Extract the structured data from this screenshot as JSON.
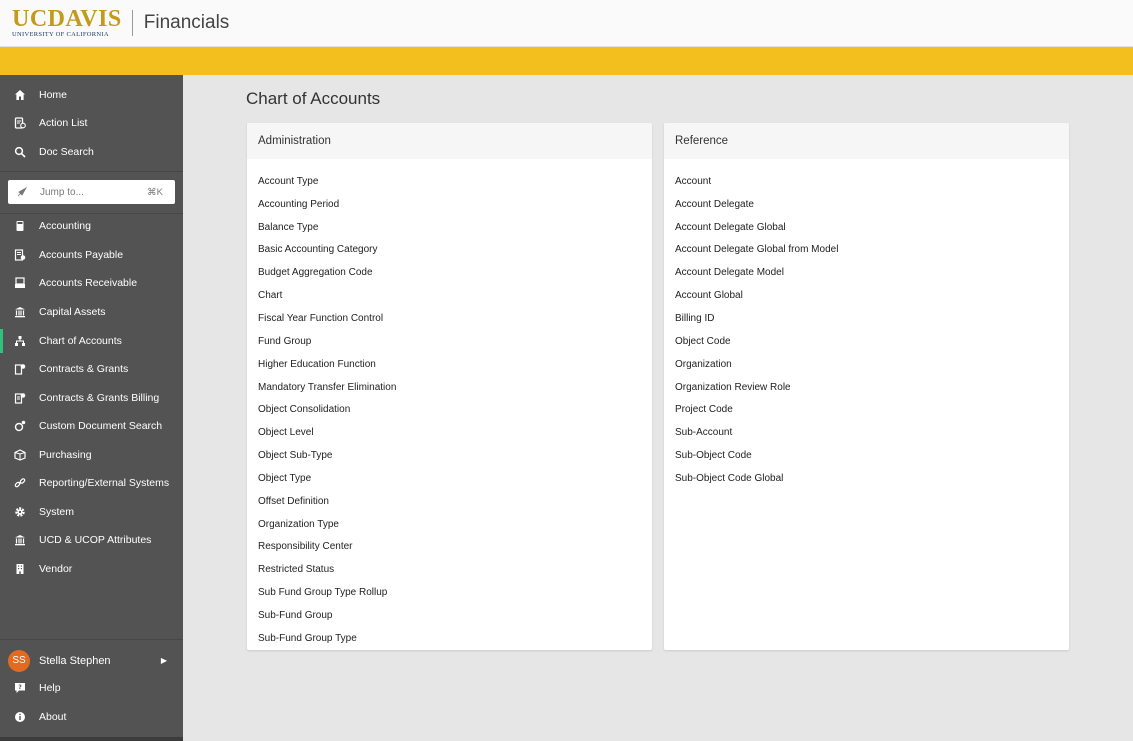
{
  "header": {
    "logo_main": "UCDAVIS",
    "logo_sub": "UNIVERSITY OF CALIFORNIA",
    "app_title": "Financials"
  },
  "colors": {
    "gold": "#f3bf1e",
    "sidebar": "#535353",
    "active_indicator": "#2ec27e",
    "avatar": "#e26a21"
  },
  "sidebar": {
    "top_items": [
      {
        "label": "Home",
        "icon": "home-icon"
      },
      {
        "label": "Action List",
        "icon": "action-list-icon"
      },
      {
        "label": "Doc Search",
        "icon": "search-icon"
      }
    ],
    "jump": {
      "placeholder": "Jump to...",
      "shortcut": "⌘K"
    },
    "modules": [
      {
        "label": "Accounting",
        "icon": "calculator-icon"
      },
      {
        "label": "Accounts Payable",
        "icon": "payable-icon"
      },
      {
        "label": "Accounts Receivable",
        "icon": "receivable-icon"
      },
      {
        "label": "Capital Assets",
        "icon": "bank-icon"
      },
      {
        "label": "Chart of Accounts",
        "icon": "sitemap-icon",
        "active": true
      },
      {
        "label": "Contracts & Grants",
        "icon": "grants-icon"
      },
      {
        "label": "Contracts & Grants Billing",
        "icon": "grants-billing-icon"
      },
      {
        "label": "Custom Document Search",
        "icon": "document-search-icon"
      },
      {
        "label": "Purchasing",
        "icon": "box-icon"
      },
      {
        "label": "Reporting/External Systems",
        "icon": "link-icon"
      },
      {
        "label": "System",
        "icon": "gear-icon"
      },
      {
        "label": "UCD & UCOP Attributes",
        "icon": "institution-icon"
      },
      {
        "label": "Vendor",
        "icon": "building-icon"
      }
    ],
    "user": {
      "initials": "SS",
      "name": "Stella Stephen"
    },
    "bottom_items": [
      {
        "label": "Help",
        "icon": "help-icon"
      },
      {
        "label": "About",
        "icon": "info-icon"
      }
    ]
  },
  "main": {
    "title": "Chart of Accounts",
    "administration": {
      "title": "Administration",
      "items": [
        "Account Type",
        "Accounting Period",
        "Balance Type",
        "Basic Accounting Category",
        "Budget Aggregation Code",
        "Chart",
        "Fiscal Year Function Control",
        "Fund Group",
        "Higher Education Function",
        "Mandatory Transfer Elimination",
        "Object Consolidation",
        "Object Level",
        "Object Sub-Type",
        "Object Type",
        "Offset Definition",
        "Organization Type",
        "Responsibility Center",
        "Restricted Status",
        "Sub Fund Group Type Rollup",
        "Sub-Fund Group",
        "Sub-Fund Group Type"
      ]
    },
    "reference": {
      "title": "Reference",
      "items": [
        "Account",
        "Account Delegate",
        "Account Delegate Global",
        "Account Delegate Global from Model",
        "Account Delegate Model",
        "Account Global",
        "Billing ID",
        "Object Code",
        "Organization",
        "Organization Review Role",
        "Project Code",
        "Sub-Account",
        "Sub-Object Code",
        "Sub-Object Code Global"
      ]
    }
  }
}
